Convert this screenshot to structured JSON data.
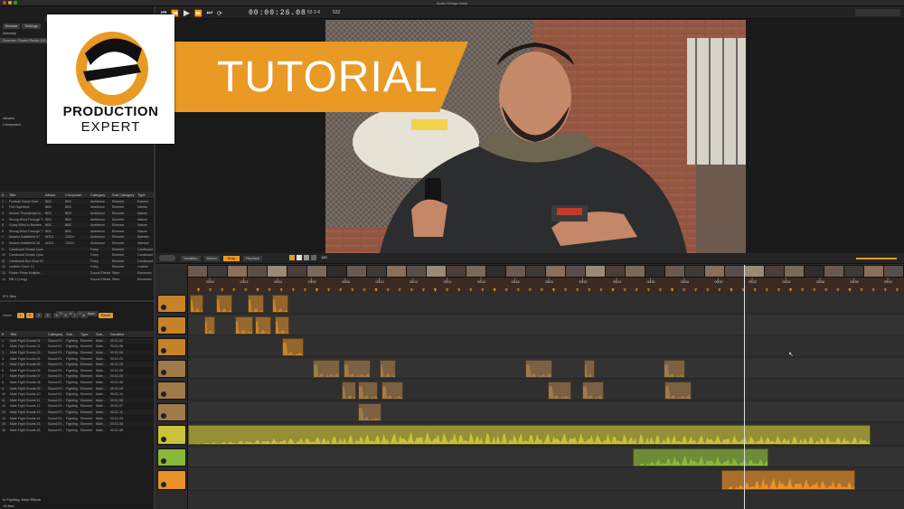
{
  "window": {
    "title": "Audio Design Desk"
  },
  "transport": {
    "timecode": "00:00:26.08",
    "bars": "53  3  4",
    "tempo": "632"
  },
  "browser": {
    "tabs": [
      "Library",
      "Search",
      "Factory"
    ],
    "subtabs": [
      "Browse",
      "Settings"
    ],
    "rows": [
      "Intensity",
      "Sources: Sound Packs (14)"
    ],
    "groups": [
      "Albums",
      "Composers"
    ],
    "columns": [
      "#",
      "Title",
      "Album",
      "Composer",
      "Category",
      "Sub Category",
      "Type"
    ],
    "files": [
      [
        "1",
        "Football Game Gear",
        "BBC",
        "BBC",
        "Ambience",
        "Element",
        "Exterior"
      ],
      [
        "2",
        "Pub Nighttime",
        "BBC",
        "BBC",
        "Ambience",
        "Element",
        "Interior"
      ],
      [
        "3",
        "Severe Thunderstorm...",
        "BBC",
        "BBC",
        "Ambience",
        "Element",
        "Nature"
      ],
      [
        "4",
        "Strong Wind Through T...",
        "BBC",
        "BBC",
        "Ambience",
        "Element",
        "Nature"
      ],
      [
        "5",
        "Gusty Wind In Bushes",
        "BBC",
        "BBC",
        "Ambience",
        "Element",
        "Nature"
      ],
      [
        "6",
        "Strong Wind Through T...",
        "BBC",
        "BBC",
        "Ambience",
        "Element",
        "Nature"
      ],
      [
        "7",
        "Modern Battlefield 07",
        "ADD1",
        "13024",
        "Ambience",
        "Element",
        "Warfare"
      ],
      [
        "8",
        "Modern Battlefield 08",
        "ADD1",
        "13024",
        "Ambience",
        "Element",
        "Warfare"
      ],
      [
        "9",
        "Cardboard Smash Quic...",
        "",
        "",
        "Foley",
        "Element",
        "Cardboard"
      ],
      [
        "10",
        "Cardboard Smash Quic...",
        "",
        "",
        "Foley",
        "Element",
        "Cardboard"
      ],
      [
        "11",
        "Cardboard Box Drop 02",
        "",
        "",
        "Foley",
        "Element",
        "Cardboard"
      ],
      [
        "12",
        "Leather Glove 13",
        "",
        "",
        "Foley",
        "Element",
        "Leather"
      ],
      [
        "13",
        "Flicker Prints Multiple...",
        "",
        "",
        "Sound Effects",
        "Stem",
        "Electronic"
      ],
      [
        "14",
        "Rift 2 (Long)",
        "",
        "",
        "Sound Effects",
        "Stem",
        "Electronic"
      ]
    ],
    "file_count": "971 files",
    "bottom_buttons": [
      "Options",
      "Triggers"
    ]
  },
  "trigger_panel": {
    "tabs": [
      "Triggers",
      "Variations"
    ],
    "level_label": "Level",
    "levels": [
      "1",
      "2",
      "3",
      "4",
      "5",
      "6",
      "7",
      "8"
    ],
    "reset": "Reset",
    "selects": [
      "Primary",
      "Assign...",
      "Main"
    ],
    "columns": [
      "#",
      "Title",
      "Category",
      "Sub...",
      "Type",
      "Sub...",
      "Duration"
    ],
    "files": [
      [
        "1",
        "Male Fight Grunts 01",
        "Sound Ef...",
        "Fighting",
        "Element",
        "Male...",
        "00:01.02"
      ],
      [
        "2",
        "Male Fight Grunts 02",
        "Sound Ef...",
        "Fighting",
        "Element",
        "Male...",
        "00:01.08"
      ],
      [
        "3",
        "Male Fight Grunts 03",
        "Sound Ef...",
        "Fighting",
        "Element",
        "Male...",
        "00:01.08"
      ],
      [
        "4",
        "Male Fight Grunts 04",
        "Sound Ef...",
        "Fighting",
        "Element",
        "Male...",
        "00:01.03"
      ],
      [
        "5",
        "Male Fight Grunts 05",
        "Sound Ef...",
        "Fighting",
        "Element",
        "Male...",
        "00:01.05"
      ],
      [
        "6",
        "Male Fight Grunts 06",
        "Sound Ef...",
        "Fighting",
        "Element",
        "Male...",
        "00:01.05"
      ],
      [
        "7",
        "Male Fight Grunts 07",
        "Sound Ef...",
        "Fighting",
        "Element",
        "Male...",
        "00:01.08"
      ],
      [
        "8",
        "Male Fight Grunts 08",
        "Sound Ef...",
        "Fighting",
        "Element",
        "Male...",
        "00:01.08"
      ],
      [
        "9",
        "Male Fight Grunts 09",
        "Sound Ef...",
        "Fighting",
        "Element",
        "Male...",
        "00:01.08"
      ],
      [
        "10",
        "Male Fight Grunts 10",
        "Sound Ef...",
        "Fighting",
        "Element",
        "Male...",
        "00:01.10"
      ],
      [
        "11",
        "Male Fight Grunts 11",
        "Sound Ef...",
        "Fighting",
        "Element",
        "Male...",
        "00:01.08"
      ],
      [
        "12",
        "Male Fight Grunts 12",
        "Sound Ef...",
        "Fighting",
        "Element",
        "Male...",
        "00:01.07"
      ],
      [
        "13",
        "Male Fight Grunts 13",
        "Sound Ef...",
        "Fighting",
        "Element",
        "Male...",
        "00:01.11"
      ],
      [
        "14",
        "Male Fight Grunts 14",
        "Sound Ef...",
        "Fighting",
        "Element",
        "Male...",
        "00:01.03"
      ],
      [
        "15",
        "Male Fight Grunts 15",
        "Sound Ef...",
        "Fighting",
        "Element",
        "Male...",
        "00:01.08"
      ],
      [
        "16",
        "Male Fight Grunts 16",
        "Sound Ef...",
        "Fighting",
        "Element",
        "Male...",
        "00:01.08"
      ]
    ],
    "footer": "in Fighting, Male Efforts",
    "footer_count": "16 files"
  },
  "overlay": {
    "brand_line1": "PRODUCTION",
    "brand_line2": "EXPERT",
    "banner": "TUTORIAL",
    "brand_color": "#e89a25"
  },
  "timeline": {
    "toolbar": [
      "Variation",
      "Select",
      "Drop",
      "Replace"
    ],
    "tempo": "120",
    "time_labels": [
      "00:00",
      "00:02",
      "00:04",
      "00:06",
      "00:08",
      "00:10",
      "00:12",
      "00:14",
      "00:16",
      "00:18",
      "00:20",
      "00:22",
      "00:24",
      "00:26",
      "00:28",
      "00:30",
      "00:32",
      "00:34",
      "00:36",
      "00:38",
      "00:40"
    ]
  }
}
